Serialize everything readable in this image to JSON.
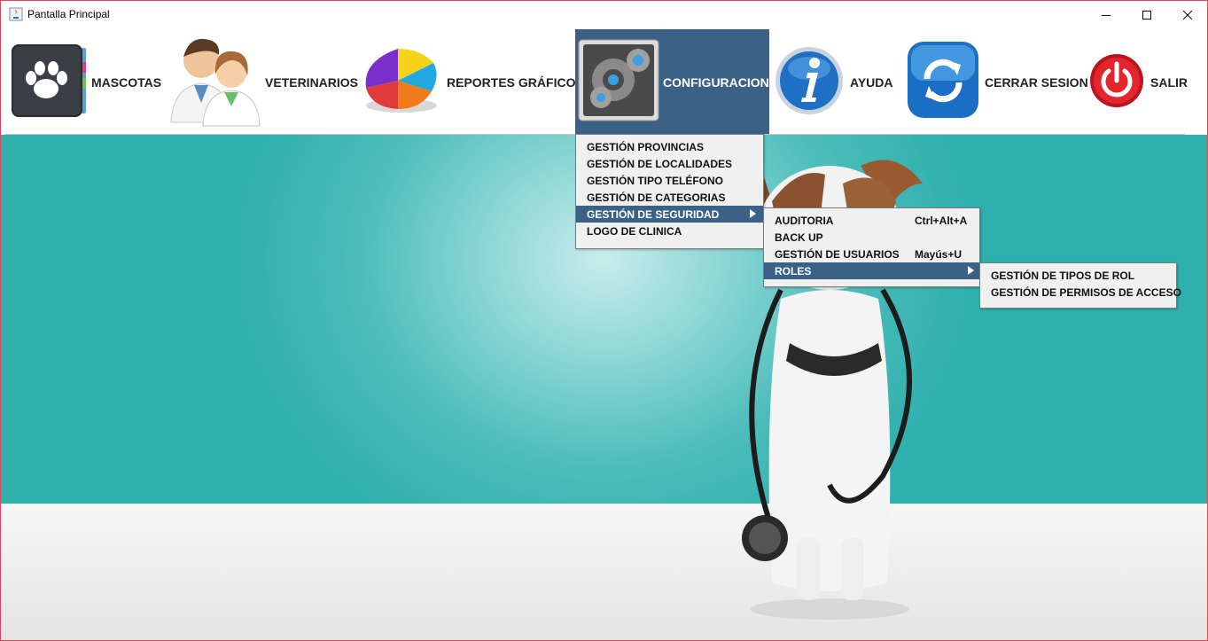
{
  "window": {
    "title": "Pantalla Principal"
  },
  "toolbar": {
    "items": [
      {
        "label": "MASCOTAS",
        "icon": "paw-book-icon"
      },
      {
        "label": "VETERINARIOS",
        "icon": "doctors-icon"
      },
      {
        "label": "REPORTES GRÁFICOS",
        "icon": "pie-chart-icon"
      },
      {
        "label": "CONFIGURACION",
        "icon": "gears-icon",
        "active": true
      },
      {
        "label": "AYUDA",
        "icon": "info-icon"
      },
      {
        "label": "CERRAR SESION",
        "icon": "refresh-icon"
      },
      {
        "label": "SALIR",
        "icon": "power-icon"
      }
    ]
  },
  "config_menu": {
    "items": [
      {
        "label": "GESTIÓN PROVINCIAS"
      },
      {
        "label": "GESTIÓN DE LOCALIDADES"
      },
      {
        "label": "GESTIÓN TIPO TELÉFONO"
      },
      {
        "label": "GESTIÓN DE CATEGORIAS"
      },
      {
        "label": "GESTIÓN DE SEGURIDAD",
        "submenu": true,
        "selected": true
      },
      {
        "label": "LOGO DE CLINICA"
      }
    ]
  },
  "security_menu": {
    "items": [
      {
        "label": "AUDITORIA",
        "shortcut": "Ctrl+Alt+A"
      },
      {
        "label": "BACK UP",
        "shortcut": ""
      },
      {
        "label": "GESTIÓN DE USUARIOS",
        "shortcut": "Mayús+U"
      },
      {
        "label": "ROLES",
        "submenu": true,
        "selected": true
      }
    ]
  },
  "roles_menu": {
    "items": [
      {
        "label": "GESTIÓN DE TIPOS DE ROL"
      },
      {
        "label": "GESTIÓN DE PERMISOS DE ACCESO"
      }
    ]
  },
  "colors": {
    "menu_selected": "#3b6186",
    "teal_background": "#2fb0ae",
    "window_border": "#d9475a"
  }
}
